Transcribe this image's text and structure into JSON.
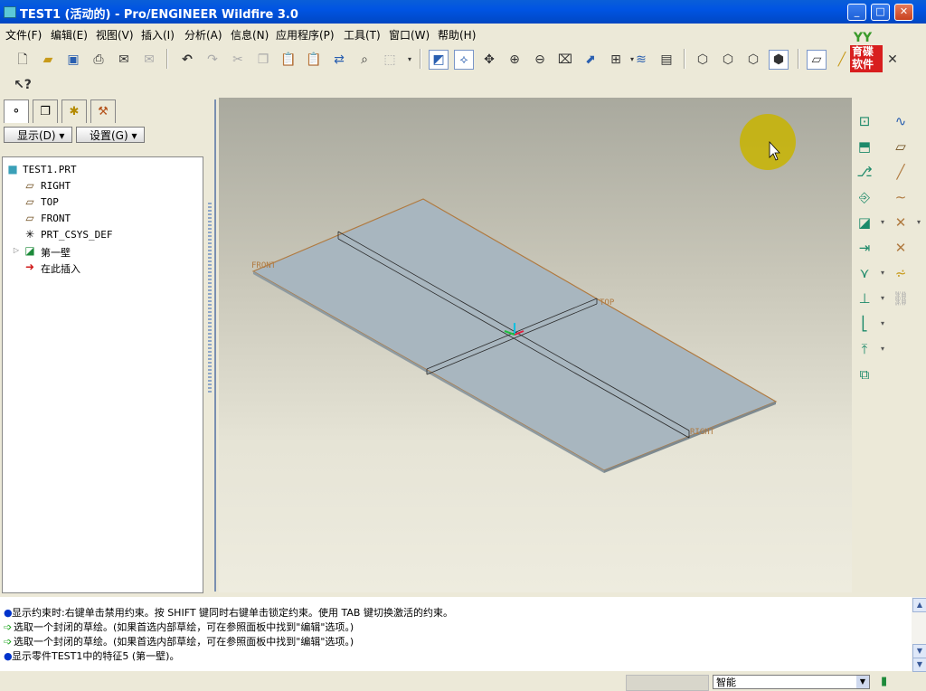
{
  "window": {
    "title": "TEST1 (活动的) - Pro/ENGINEER Wildfire 3.0",
    "min": "_",
    "max": "□",
    "close": "✕"
  },
  "menu": [
    "文件(F)",
    "编辑(E)",
    "视图(V)",
    "插入(I)",
    "分析(A)",
    "信息(N)",
    "应用程序(P)",
    "工具(T)",
    "窗口(W)",
    "帮助(H)"
  ],
  "logo": {
    "line1": "育碟",
    "line2": "软件"
  },
  "panel": {
    "show_label": "显示(D) ▾",
    "settings_label": "设置(G) ▾",
    "tree": [
      {
        "label": "TEST1.PRT",
        "icon": "part-icon"
      },
      {
        "label": "RIGHT",
        "icon": "datum-plane-icon"
      },
      {
        "label": "TOP",
        "icon": "datum-plane-icon"
      },
      {
        "label": "FRONT",
        "icon": "datum-plane-icon"
      },
      {
        "label": "PRT_CSYS_DEF",
        "icon": "csys-icon"
      },
      {
        "label": "第一壁",
        "icon": "sheetmetal-wall-icon"
      },
      {
        "label": "在此插入",
        "icon": "insert-here-arrow-icon"
      }
    ]
  },
  "viewport": {
    "labels": {
      "front": "FRONT",
      "top": "TOP",
      "right": "RIGHT"
    },
    "plate_color": "#a8b6bf",
    "edge_color": "#b07a40"
  },
  "messages": [
    {
      "type": "info",
      "text": "显示约束时:右键单击禁用约束。按 SHIFT 键同时右键单击锁定约束。使用 TAB 键切换激活的约束。"
    },
    {
      "type": "prompt",
      "text": "选取一个封闭的草绘。(如果首选内部草绘，可在参照面板中找到\"编辑\"选项。)"
    },
    {
      "type": "prompt",
      "text": "选取一个封闭的草绘。(如果首选内部草绘，可在参照面板中找到\"编辑\"选项。)"
    },
    {
      "type": "info",
      "text": "显示零件TEST1中的特征5 (第一壁)。"
    }
  ],
  "status": {
    "filter": "智能"
  }
}
